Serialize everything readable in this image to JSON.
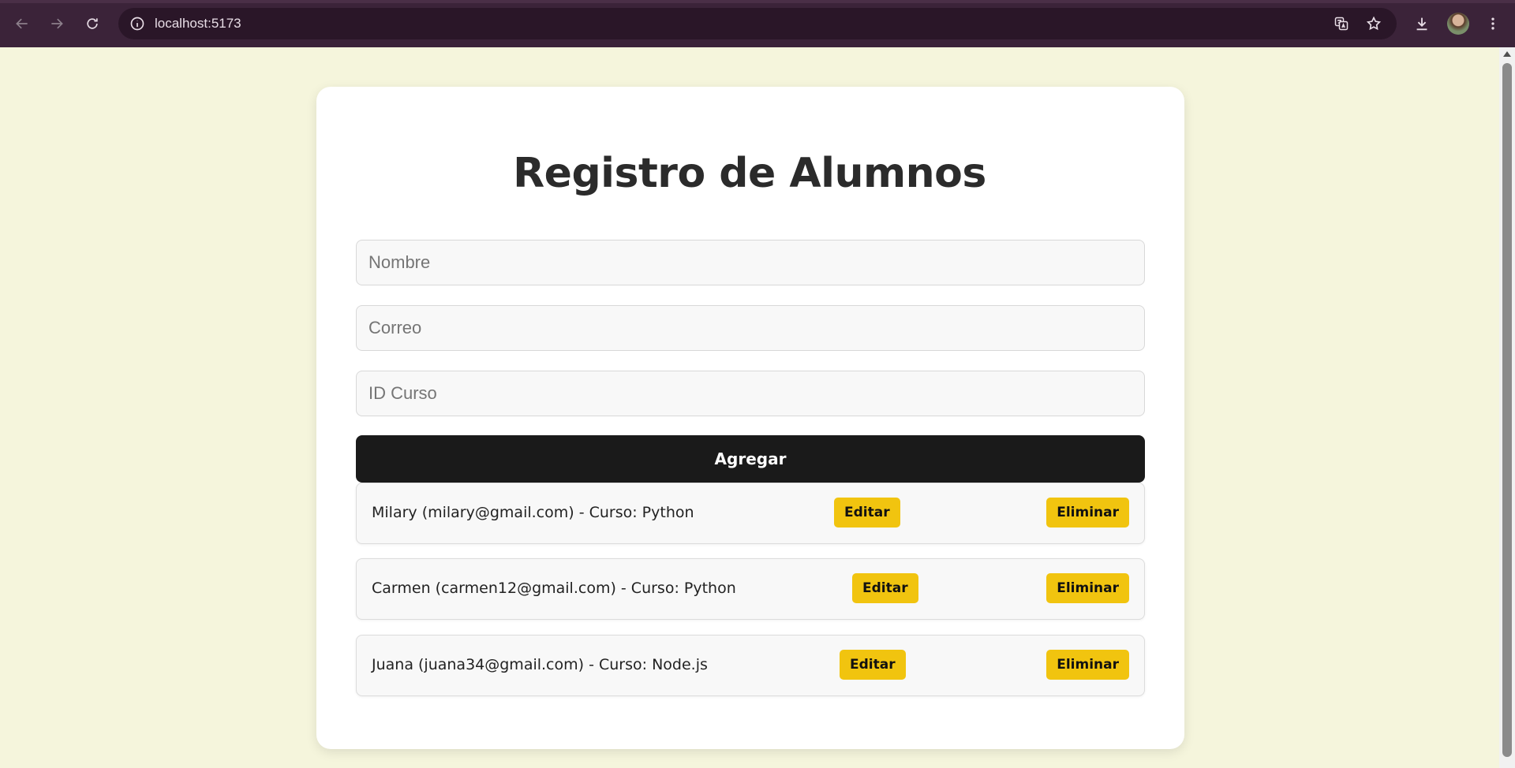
{
  "browser": {
    "url": "localhost:5173"
  },
  "app": {
    "title": "Registro de Alumnos",
    "form": {
      "name_placeholder": "Nombre",
      "email_placeholder": "Correo",
      "course_placeholder": "ID Curso",
      "submit_label": "Agregar"
    },
    "students": [
      {
        "text": "Milary (milary@gmail.com) - Curso: Python",
        "edit_label": "Editar",
        "delete_label": "Eliminar"
      },
      {
        "text": "Carmen (carmen12@gmail.com) - Curso: Python",
        "edit_label": "Editar",
        "delete_label": "Eliminar"
      },
      {
        "text": "Juana (juana34@gmail.com) - Curso: Node.js",
        "edit_label": "Editar",
        "delete_label": "Eliminar"
      }
    ]
  },
  "colors": {
    "page_background": "#f5f5dc",
    "chrome_background": "#3b2339",
    "button_primary": "#1a1a1a",
    "button_accent": "#f1c40f"
  }
}
